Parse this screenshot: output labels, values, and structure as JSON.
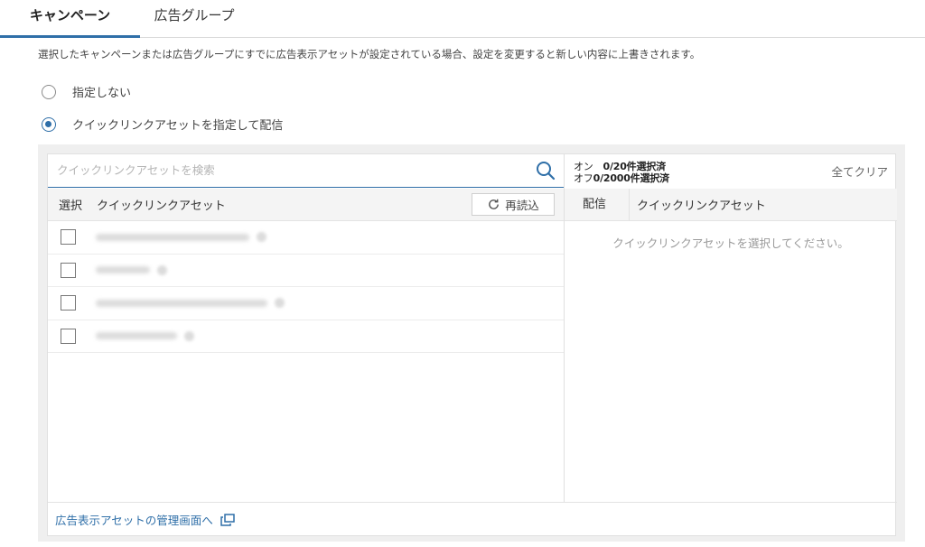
{
  "tabs": [
    {
      "label": "キャンペーン",
      "active": true
    },
    {
      "label": "広告グループ",
      "active": false
    }
  ],
  "notice": "選択したキャンペーンまたは広告グループにすでに広告表示アセットが設定されている場合、設定を変更すると新しい内容に上書きされます。",
  "radios": [
    {
      "label": "指定しない",
      "checked": false
    },
    {
      "label": "クイックリンクアセットを指定して配信",
      "checked": true
    }
  ],
  "left_panel": {
    "search_placeholder": "クイックリンクアセットを検索",
    "col_select": "選択",
    "col_name": "クイックリンクアセット",
    "reload_label": "再読込",
    "rows": [
      {
        "checked": false
      },
      {
        "checked": false
      },
      {
        "checked": false
      },
      {
        "checked": false
      }
    ]
  },
  "right_panel": {
    "on_label": "オン",
    "on_count": "0/20件選択済",
    "off_label": "オフ",
    "off_count": "0/2000件選択済",
    "clear_all": "全てクリア",
    "col_deliver": "配信",
    "col_name": "クイックリンクアセット",
    "empty_message": "クイックリンクアセットを選択してください。"
  },
  "footer": {
    "link_label": "広告表示アセットの管理画面へ"
  },
  "colors": {
    "accent": "#2f6fa8",
    "panel_bg": "#efefef",
    "header_bg": "#f4f4f4"
  }
}
